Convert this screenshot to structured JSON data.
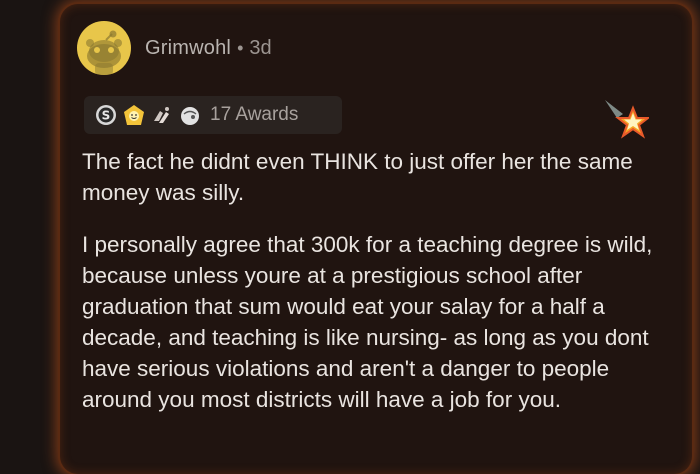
{
  "comment": {
    "author": "Grimwohl",
    "separator": "•",
    "age": "3d",
    "avatar_icon": "snoo-avatar-icon",
    "awards": {
      "icons": [
        "silver-award-icon",
        "wholesome-award-icon",
        "hands-award-icon",
        "helpful-award-icon"
      ],
      "label": "17 Awards"
    },
    "gold_award_icon": "star-award-icon",
    "paragraphs": [
      "The fact he didnt even THINK to just offer her the same money was silly.",
      "I personally agree that 300k for a teaching degree is wild, because unless youre at a prestigious school after graduation that sum would eat your salay for a half a decade, and teaching is like nursing- as long as you dont have serious violations and aren't a danger to people around you most districts will have a job for you."
    ]
  },
  "colors": {
    "card_glow": "#d25a1e",
    "card_bg": "#201410",
    "avatar_bg": "#e8c64a",
    "text": "#e9e4e0",
    "muted": "#9c9591"
  }
}
